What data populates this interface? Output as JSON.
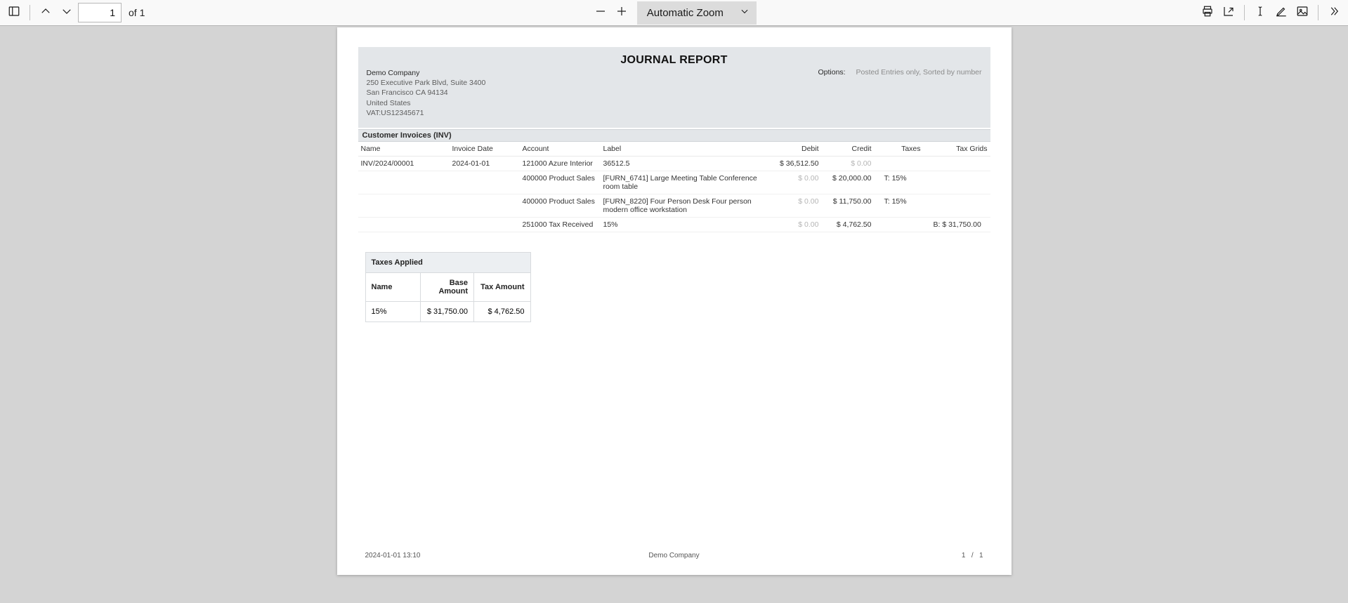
{
  "toolbar": {
    "page_current": "1",
    "page_of_prefix": "of",
    "page_total": "1",
    "zoom_label": "Automatic Zoom"
  },
  "report": {
    "title": "JOURNAL REPORT",
    "company": {
      "name": "Demo Company",
      "addr1": "250 Executive Park Blvd, Suite 3400",
      "addr2": "San Francisco CA 94134",
      "country": "United States",
      "vat": "VAT:US12345671"
    },
    "options_label": "Options:",
    "options_value": "Posted Entries only, Sorted by number",
    "section": "Customer Invoices (INV)",
    "columns": {
      "name": "Name",
      "invoice_date": "Invoice Date",
      "account": "Account",
      "label": "Label",
      "debit": "Debit",
      "credit": "Credit",
      "taxes": "Taxes",
      "tax_grids": "Tax Grids"
    },
    "entry": {
      "name": "INV/2024/00001",
      "invoice_date": "2024-01-01"
    },
    "lines": [
      {
        "account": "121000 Azure Interior",
        "label": "36512.5",
        "debit": "$ 36,512.50",
        "credit": "$ 0.00",
        "taxes": "",
        "tax_grids": ""
      },
      {
        "account": "400000 Product Sales",
        "label": "[FURN_6741] Large Meeting Table Conference room table",
        "debit": "$ 0.00",
        "credit": "$ 20,000.00",
        "taxes": "T: 15%",
        "tax_grids": ""
      },
      {
        "account": "400000 Product Sales",
        "label": "[FURN_8220] Four Person Desk Four person modern office workstation",
        "debit": "$ 0.00",
        "credit": "$ 11,750.00",
        "taxes": "T: 15%",
        "tax_grids": ""
      },
      {
        "account": "251000 Tax Received",
        "label": "15%",
        "debit": "$ 0.00",
        "credit": "$ 4,762.50",
        "taxes": "",
        "tax_grids": "B: $ 31,750.00"
      }
    ],
    "taxes_applied": {
      "title": "Taxes Applied",
      "col_name": "Name",
      "col_base": "Base Amount",
      "col_tax": "Tax Amount",
      "rows": [
        {
          "name": "15%",
          "base": "$ 31,750.00",
          "tax": "$ 4,762.50"
        }
      ]
    },
    "footer": {
      "timestamp": "2024-01-01 13:10",
      "center": "Demo Company",
      "page_num": "1",
      "page_sep": "/",
      "page_total": "1"
    }
  }
}
